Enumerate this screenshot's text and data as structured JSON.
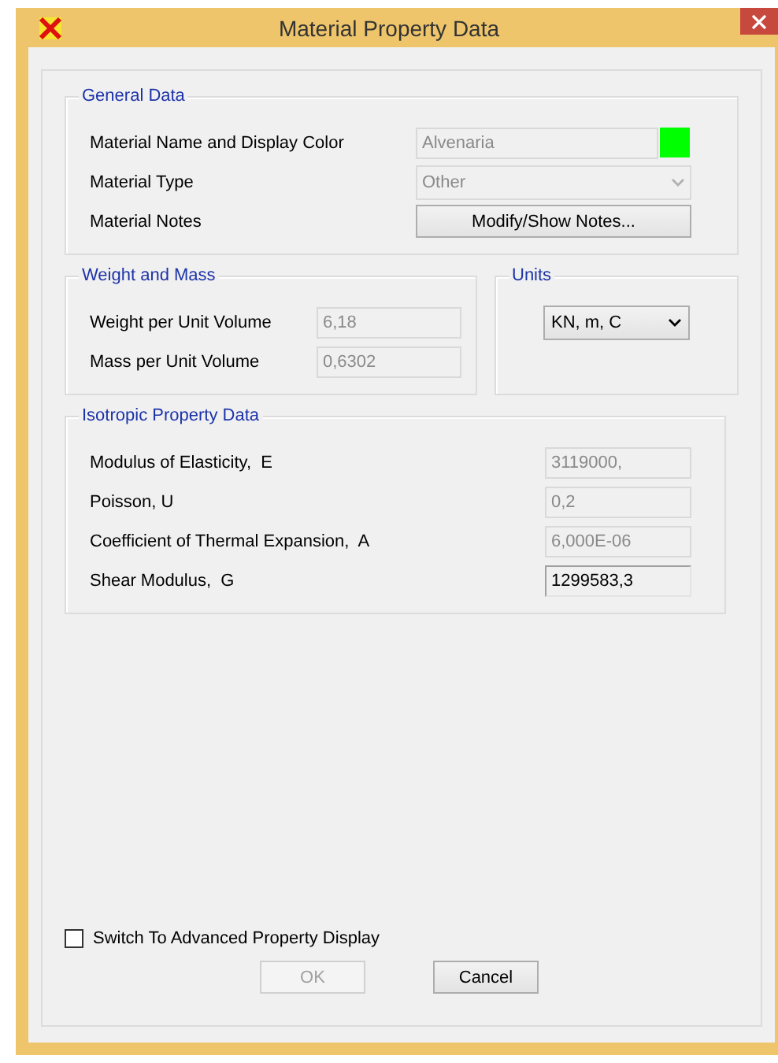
{
  "window": {
    "title": "Material Property Data"
  },
  "general_data": {
    "title": "General Data",
    "rows": [
      {
        "kind": "text",
        "label": "Material Name and Display Color",
        "value": "Alvenaria",
        "disabled": true,
        "color": "#00ff00"
      },
      {
        "kind": "combo",
        "label": "Material Type",
        "value": "Other",
        "disabled": true
      },
      {
        "kind": "button",
        "label": "Material Notes",
        "value": "Modify/Show Notes...",
        "disabled": false
      }
    ]
  },
  "weight_and_mass": {
    "title": "Weight and Mass",
    "rows": [
      {
        "label": "Weight per Unit Volume",
        "value": "6,18",
        "disabled": true
      },
      {
        "label": "Mass per Unit Volume",
        "value": "0,6302",
        "disabled": true
      }
    ]
  },
  "units": {
    "title": "Units",
    "value": "KN, m, C"
  },
  "isotropic_property_data": {
    "title": "Isotropic Property Data",
    "rows": [
      {
        "label": "Modulus of Elasticity,  E",
        "value": "3119000,",
        "disabled": true
      },
      {
        "label": "Poisson, U",
        "value": "0,2",
        "disabled": true
      },
      {
        "label": "Coefficient of Thermal Expansion,  A",
        "value": "6,000E-06",
        "disabled": true
      },
      {
        "label": "Shear Modulus,  G",
        "value": "1299583,3",
        "disabled": false
      }
    ]
  },
  "advanced_display": {
    "label": "Switch To Advanced Property Display",
    "checked": false
  },
  "buttons": [
    {
      "label": "OK",
      "disabled": true
    },
    {
      "label": "Cancel",
      "disabled": false
    }
  ]
}
